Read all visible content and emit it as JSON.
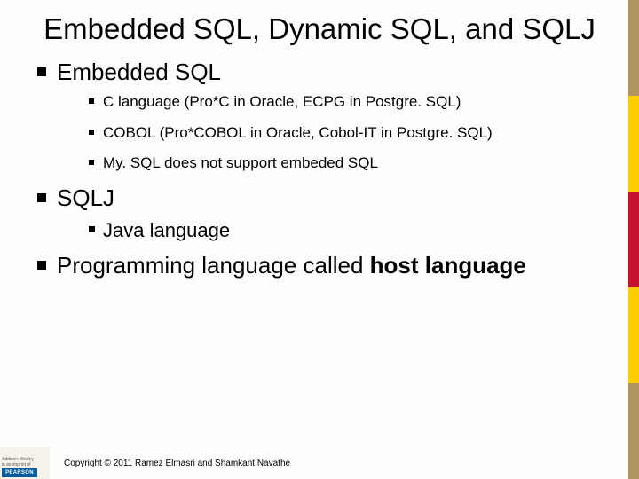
{
  "title": "Embedded SQL, Dynamic SQL, and SQLJ",
  "sections": {
    "embedded": {
      "heading": "Embedded SQL",
      "items": [
        "C language (Pro*C in Oracle, ECPG in Postgre. SQL)",
        "COBOL (Pro*COBOL in Oracle, Cobol-IT in Postgre. SQL)",
        "My. SQL does not support embeded SQL"
      ]
    },
    "sqlj": {
      "heading": "SQLJ",
      "items": [
        "Java language"
      ]
    },
    "host": {
      "prefix": "Programming language called ",
      "bold": "host language"
    }
  },
  "footer": {
    "brand_small": "Addison-Wesley",
    "brand_sub": "is an imprint of",
    "brand_main": "PEARSON",
    "copyright": "Copyright © 2011 Ramez Elmasri and Shamkant Navathe"
  }
}
